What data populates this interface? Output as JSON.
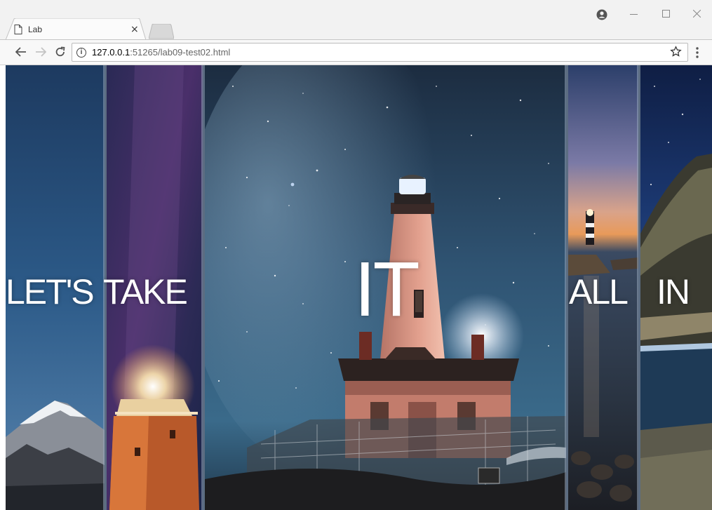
{
  "browser": {
    "tab_title": "Lab",
    "tab_close": "×",
    "url_host": "127.0.0.1",
    "url_rest": ":51265/lab09-test02.html",
    "icons": [
      "page-icon",
      "close-icon",
      "back-icon",
      "forward-icon",
      "reload-icon",
      "info-icon",
      "star-icon",
      "menu-icon",
      "account-icon",
      "minimize-icon",
      "maximize-icon",
      "close-window-icon"
    ]
  },
  "page": {
    "captions": {
      "lets": "LET'S",
      "take": "TAKE",
      "it": "IT",
      "all": "ALL",
      "in": "IN"
    },
    "colors": {
      "night_sky": "#1c3350",
      "milky_way": "#2b2350",
      "lighthouse_glow": "#fff6e0",
      "sunset": "#e89a5a"
    }
  }
}
